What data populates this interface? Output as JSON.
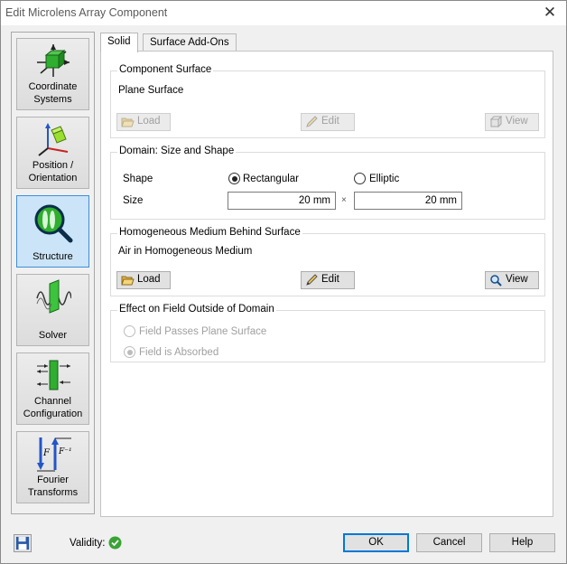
{
  "window": {
    "title": "Edit Microlens Array Component",
    "close_glyph": "✕"
  },
  "nav": {
    "items": [
      {
        "label_line1": "Coordinate",
        "label_line2": "Systems",
        "icon": "coordinate-systems-icon"
      },
      {
        "label_line1": "Position /",
        "label_line2": "Orientation",
        "icon": "position-orientation-icon"
      },
      {
        "label_line1": "Structure",
        "label_line2": "",
        "icon": "structure-icon",
        "active": true
      },
      {
        "label_line1": "Solver",
        "label_line2": "",
        "icon": "solver-icon"
      },
      {
        "label_line1": "Channel",
        "label_line2": "Configuration",
        "icon": "channel-configuration-icon"
      },
      {
        "label_line1": "Fourier",
        "label_line2": "Transforms",
        "icon": "fourier-transforms-icon"
      }
    ]
  },
  "tabs": {
    "solid": "Solid",
    "surface_addons": "Surface Add-Ons"
  },
  "component_surface": {
    "title": "Component Surface",
    "value": "Plane Surface",
    "load": "Load",
    "edit": "Edit",
    "view": "View"
  },
  "domain": {
    "title": "Domain: Size and Shape",
    "shape_label": "Shape",
    "rectangular": "Rectangular",
    "elliptic": "Elliptic",
    "size_label": "Size",
    "size_x": "20 mm",
    "times": "×",
    "size_y": "20 mm"
  },
  "medium": {
    "title": "Homogeneous Medium Behind Surface",
    "value": "Air in Homogeneous Medium",
    "load": "Load",
    "edit": "Edit",
    "view": "View"
  },
  "effect": {
    "title": "Effect on Field Outside of Domain",
    "passes": "Field Passes Plane Surface",
    "absorbed": "Field is Absorbed"
  },
  "footer": {
    "validity": "Validity:",
    "ok": "OK",
    "cancel": "Cancel",
    "help": "Help"
  },
  "colors": {
    "accent": "#0078d7",
    "valid": "#3aa335",
    "active_nav": "#cce4f7"
  }
}
